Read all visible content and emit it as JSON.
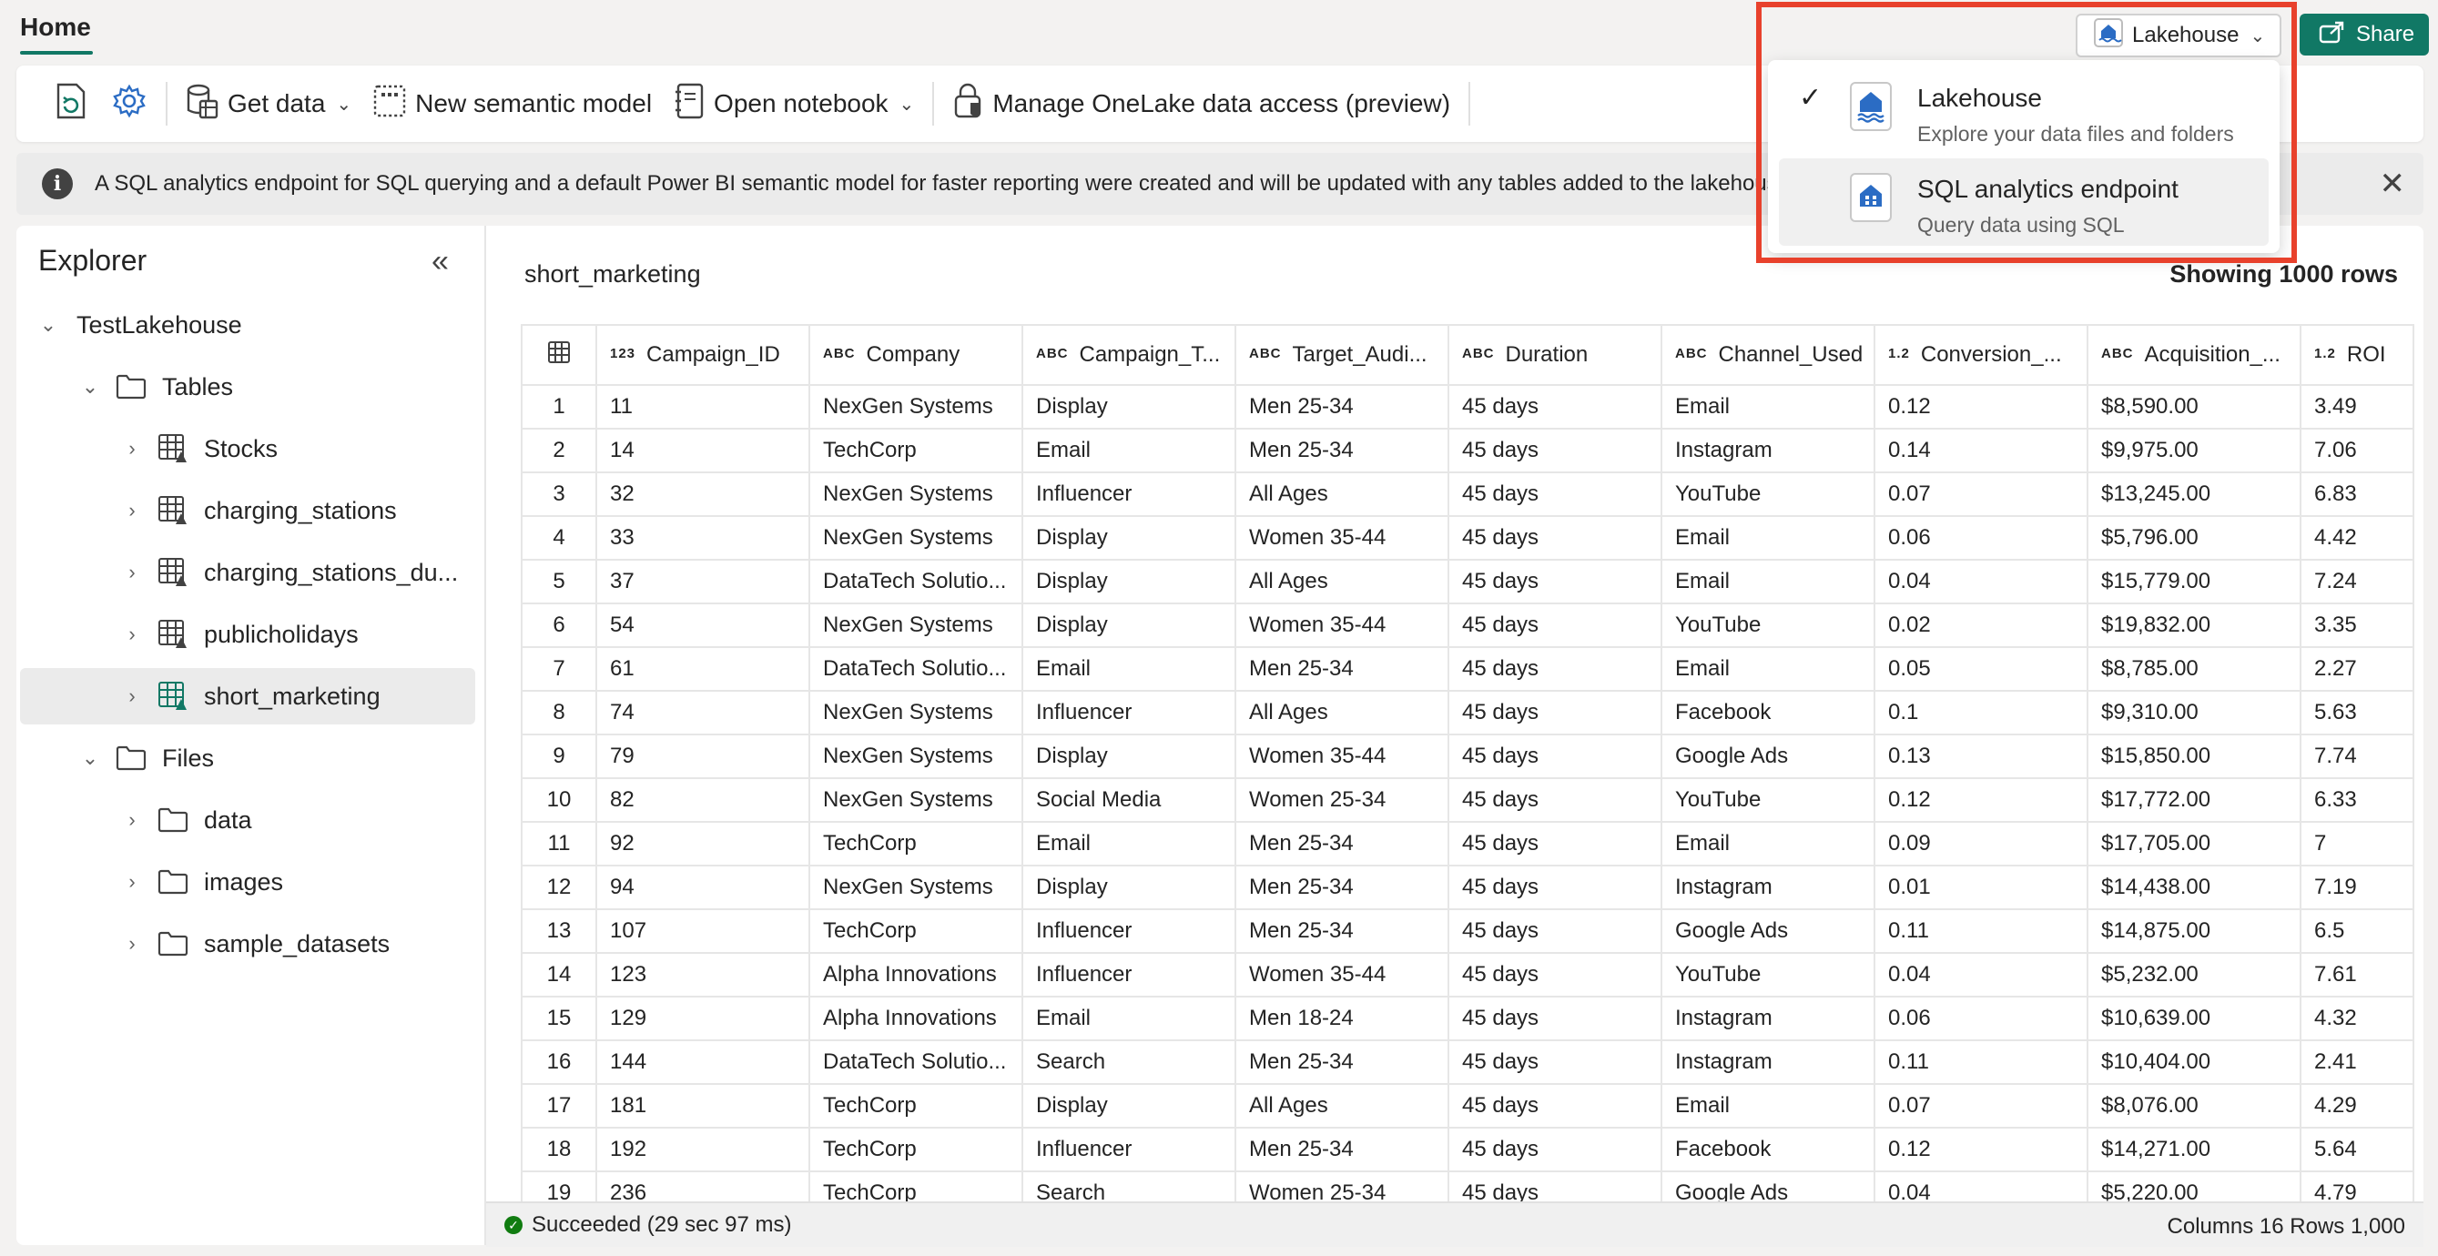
{
  "topbar": {
    "home_tab": "Home",
    "lakehouse_switch_label": "Lakehouse",
    "share_label": "Share"
  },
  "ribbon": {
    "get_data": "Get data",
    "new_semantic_model": "New semantic model",
    "open_notebook": "Open notebook",
    "manage_onelake": "Manage OneLake data access (preview)"
  },
  "infobar": {
    "message": "A SQL analytics endpoint for SQL querying and a default Power BI semantic model for faster reporting were created and will be updated with any tables added to the lakehouse."
  },
  "explorer": {
    "title": "Explorer",
    "root": "TestLakehouse",
    "tables_label": "Tables",
    "tables": [
      "Stocks",
      "charging_stations",
      "charging_stations_du...",
      "publicholidays",
      "short_marketing"
    ],
    "files_label": "Files",
    "files": [
      "data",
      "images",
      "sample_datasets"
    ]
  },
  "grid": {
    "table_name": "short_marketing",
    "row_count_label": "Showing 1000 rows",
    "columns": [
      {
        "type": "123",
        "name": "Campaign_ID"
      },
      {
        "type": "ABC",
        "name": "Company"
      },
      {
        "type": "ABC",
        "name": "Campaign_T..."
      },
      {
        "type": "ABC",
        "name": "Target_Audi..."
      },
      {
        "type": "ABC",
        "name": "Duration"
      },
      {
        "type": "ABC",
        "name": "Channel_Used"
      },
      {
        "type": "1.2",
        "name": "Conversion_..."
      },
      {
        "type": "ABC",
        "name": "Acquisition_..."
      },
      {
        "type": "1.2",
        "name": "ROI"
      }
    ],
    "rows": [
      [
        "1",
        "11",
        "NexGen Systems",
        "Display",
        "Men 25-34",
        "45 days",
        "Email",
        "0.12",
        "$8,590.00",
        "3.49"
      ],
      [
        "2",
        "14",
        "TechCorp",
        "Email",
        "Men 25-34",
        "45 days",
        "Instagram",
        "0.14",
        "$9,975.00",
        "7.06"
      ],
      [
        "3",
        "32",
        "NexGen Systems",
        "Influencer",
        "All Ages",
        "45 days",
        "YouTube",
        "0.07",
        "$13,245.00",
        "6.83"
      ],
      [
        "4",
        "33",
        "NexGen Systems",
        "Display",
        "Women 35-44",
        "45 days",
        "Email",
        "0.06",
        "$5,796.00",
        "4.42"
      ],
      [
        "5",
        "37",
        "DataTech Solutio...",
        "Display",
        "All Ages",
        "45 days",
        "Email",
        "0.04",
        "$15,779.00",
        "7.24"
      ],
      [
        "6",
        "54",
        "NexGen Systems",
        "Display",
        "Women 35-44",
        "45 days",
        "YouTube",
        "0.02",
        "$19,832.00",
        "3.35"
      ],
      [
        "7",
        "61",
        "DataTech Solutio...",
        "Email",
        "Men 25-34",
        "45 days",
        "Email",
        "0.05",
        "$8,785.00",
        "2.27"
      ],
      [
        "8",
        "74",
        "NexGen Systems",
        "Influencer",
        "All Ages",
        "45 days",
        "Facebook",
        "0.1",
        "$9,310.00",
        "5.63"
      ],
      [
        "9",
        "79",
        "NexGen Systems",
        "Display",
        "Women 35-44",
        "45 days",
        "Google Ads",
        "0.13",
        "$15,850.00",
        "7.74"
      ],
      [
        "10",
        "82",
        "NexGen Systems",
        "Social Media",
        "Women 25-34",
        "45 days",
        "YouTube",
        "0.12",
        "$17,772.00",
        "6.33"
      ],
      [
        "11",
        "92",
        "TechCorp",
        "Email",
        "Men 25-34",
        "45 days",
        "Email",
        "0.09",
        "$17,705.00",
        "7"
      ],
      [
        "12",
        "94",
        "NexGen Systems",
        "Display",
        "Men 25-34",
        "45 days",
        "Instagram",
        "0.01",
        "$14,438.00",
        "7.19"
      ],
      [
        "13",
        "107",
        "TechCorp",
        "Influencer",
        "Men 25-34",
        "45 days",
        "Google Ads",
        "0.11",
        "$14,875.00",
        "6.5"
      ],
      [
        "14",
        "123",
        "Alpha Innovations",
        "Influencer",
        "Women 35-44",
        "45 days",
        "YouTube",
        "0.04",
        "$5,232.00",
        "7.61"
      ],
      [
        "15",
        "129",
        "Alpha Innovations",
        "Email",
        "Men 18-24",
        "45 days",
        "Instagram",
        "0.06",
        "$10,639.00",
        "4.32"
      ],
      [
        "16",
        "144",
        "DataTech Solutio...",
        "Search",
        "Men 25-34",
        "45 days",
        "Instagram",
        "0.11",
        "$10,404.00",
        "2.41"
      ],
      [
        "17",
        "181",
        "TechCorp",
        "Display",
        "All Ages",
        "45 days",
        "Email",
        "0.07",
        "$8,076.00",
        "4.29"
      ],
      [
        "18",
        "192",
        "TechCorp",
        "Influencer",
        "Men 25-34",
        "45 days",
        "Facebook",
        "0.12",
        "$14,271.00",
        "5.64"
      ],
      [
        "19",
        "236",
        "TechCorp",
        "Search",
        "Women 25-34",
        "45 days",
        "Google Ads",
        "0.04",
        "$5,220.00",
        "4.79"
      ]
    ]
  },
  "status": {
    "message": "Succeeded (29 sec 97 ms)",
    "summary": "Columns 16 Rows 1,000"
  },
  "dropdown": {
    "items": [
      {
        "title": "Lakehouse",
        "subtitle": "Explore your data files and folders",
        "checked": true
      },
      {
        "title": "SQL analytics endpoint",
        "subtitle": "Query data using SQL",
        "checked": false
      }
    ]
  },
  "colors": {
    "accent": "#117865",
    "highlight": "#e8412c",
    "lakehouse_icon": "#2b6cc4"
  }
}
